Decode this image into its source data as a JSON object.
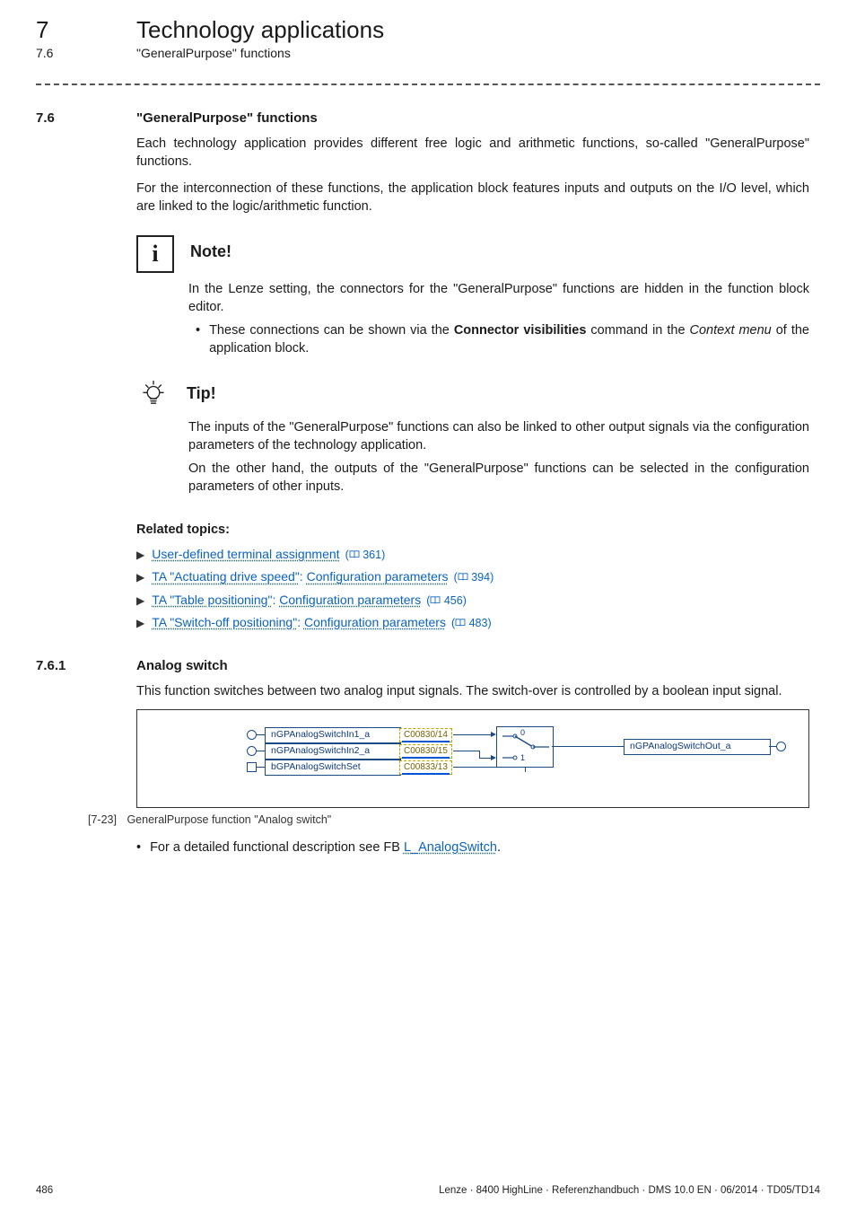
{
  "header": {
    "chapter_num": "7",
    "chapter_title": "Technology applications",
    "section_num": "7.6",
    "section_title": "\"GeneralPurpose\" functions"
  },
  "section_7_6": {
    "num": "7.6",
    "title": "\"GeneralPurpose\" functions",
    "p1": "Each technology application provides different free logic and arithmetic functions, so-called \"GeneralPurpose\" functions.",
    "p2": "For the interconnection of these functions, the application block features inputs and outputs on the I/O level, which are linked to the logic/arithmetic function."
  },
  "note": {
    "title": "Note!",
    "p1": "In the Lenze setting, the connectors for the \"GeneralPurpose\" functions are hidden in the function block editor.",
    "bullet_pre": "These connections can be shown via the ",
    "bullet_bold": "Connector visibilities",
    "bullet_mid": " command in the ",
    "bullet_italic": "Context menu",
    "bullet_post": " of the application block."
  },
  "tip": {
    "title": "Tip!",
    "p1": "The inputs of the \"GeneralPurpose\" functions can also be linked to other output signals via the configuration parameters of the technology application.",
    "p2": "On the other hand, the outputs of the \"GeneralPurpose\" functions can be selected in the configuration parameters of other inputs."
  },
  "related": {
    "heading": "Related topics:",
    "items": [
      {
        "pre": "",
        "link": "User-defined terminal assignment",
        "page": "361"
      },
      {
        "pre_link": "TA \"Actuating drive speed\"",
        "sep": ": ",
        "link": "Configuration parameters",
        "page": "394"
      },
      {
        "pre_link": "TA \"Table positioning\"",
        "sep": ": ",
        "link": "Configuration parameters",
        "page": "456"
      },
      {
        "pre_link": "TA \"Switch-off positioning\"",
        "sep": ": ",
        "link": "Configuration parameters",
        "page": "483"
      }
    ]
  },
  "section_7_6_1": {
    "num": "7.6.1",
    "title": "Analog switch",
    "p1": "This function switches between two analog input signals. The switch-over is controlled by a boolean input signal."
  },
  "diagram": {
    "in1": "nGPAnalogSwitchIn1_a",
    "in2": "nGPAnalogSwitchIn2_a",
    "set": "bGPAnalogSwitchSet",
    "c1": "C00830/14",
    "c2": "C00830/15",
    "c3": "C00833/13",
    "idx0": "0",
    "idx1": "1",
    "out": "nGPAnalogSwitchOut_a"
  },
  "figure_caption": {
    "num": "[7-23]",
    "text": "GeneralPurpose function \"Analog switch\""
  },
  "post_fig_bullet": {
    "pre": "For a detailed functional description see FB ",
    "link": "L_AnalogSwitch",
    "post": "."
  },
  "footer": {
    "page": "486",
    "doc": "Lenze · 8400 HighLine · Referenzhandbuch · DMS 10.0 EN · 06/2014 · TD05/TD14"
  }
}
